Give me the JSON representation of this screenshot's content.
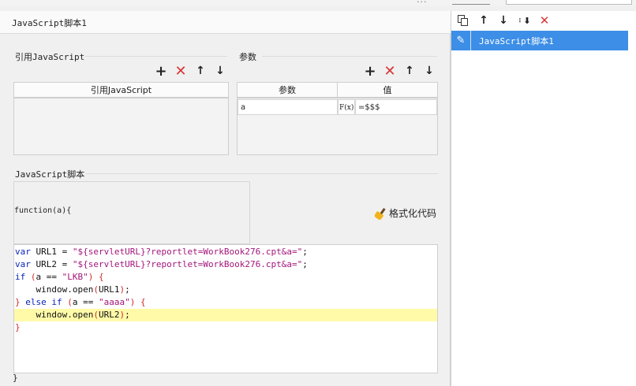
{
  "top": {
    "overflow_dots": "···"
  },
  "editor_panel": {
    "title": "JavaScript脚本1",
    "imports": {
      "group_label": "引用JavaScript",
      "column_header": "引用JavaScript"
    },
    "params": {
      "group_label": "参数",
      "columns": [
        "参数",
        "值"
      ],
      "rows": [
        {
          "name": "a",
          "formula_button": "F(x)",
          "value": "=$$$"
        }
      ]
    },
    "script": {
      "group_label": "JavaScript脚本",
      "signature": "function(a){",
      "format_button": "格式化代码",
      "closing": "}",
      "lines": [
        {
          "tokens": [
            {
              "c": "kw",
              "t": "var"
            },
            {
              "c": "plain",
              "t": " URL1 = "
            },
            {
              "c": "str",
              "t": "\"${servletURL}?reportlet=WorkBook276.cpt&a=\""
            },
            {
              "c": "plain",
              "t": ";"
            }
          ]
        },
        {
          "tokens": [
            {
              "c": "kw",
              "t": "var"
            },
            {
              "c": "plain",
              "t": " URL2 = "
            },
            {
              "c": "str",
              "t": "\"${servletURL}?reportlet=WorkBook276.cpt&a=\""
            },
            {
              "c": "plain",
              "t": ";"
            }
          ]
        },
        {
          "tokens": [
            {
              "c": "kw",
              "t": "if"
            },
            {
              "c": "plain",
              "t": " "
            },
            {
              "c": "br",
              "t": "("
            },
            {
              "c": "plain",
              "t": "a == "
            },
            {
              "c": "str",
              "t": "\"LKB\""
            },
            {
              "c": "br",
              "t": ")"
            },
            {
              "c": "plain",
              "t": " "
            },
            {
              "c": "br",
              "t": "{"
            }
          ]
        },
        {
          "tokens": [
            {
              "c": "plain",
              "t": "    window.open"
            },
            {
              "c": "br",
              "t": "("
            },
            {
              "c": "plain",
              "t": "URL1"
            },
            {
              "c": "br",
              "t": ")"
            },
            {
              "c": "plain",
              "t": ";"
            }
          ]
        },
        {
          "tokens": [
            {
              "c": "br",
              "t": "}"
            },
            {
              "c": "plain",
              "t": " "
            },
            {
              "c": "kw",
              "t": "else if"
            },
            {
              "c": "plain",
              "t": " "
            },
            {
              "c": "br",
              "t": "("
            },
            {
              "c": "plain",
              "t": "a == "
            },
            {
              "c": "str",
              "t": "\"aaaa\""
            },
            {
              "c": "br",
              "t": ")"
            },
            {
              "c": "plain",
              "t": " "
            },
            {
              "c": "br",
              "t": "{"
            }
          ]
        },
        {
          "highlight": true,
          "tokens": [
            {
              "c": "plain",
              "t": "    window.open"
            },
            {
              "c": "br",
              "t": "("
            },
            {
              "c": "plain",
              "t": "URL2"
            },
            {
              "c": "br",
              "t": ")"
            },
            {
              "c": "plain",
              "t": ";"
            }
          ]
        },
        {
          "tokens": [
            {
              "c": "br",
              "t": "}"
            }
          ]
        }
      ]
    }
  },
  "toolbar_icons": {
    "add": "+",
    "delete": "✕",
    "up": "↑",
    "down": "↓"
  },
  "right_panel": {
    "icons": {
      "up": "↑",
      "down": "↓",
      "delete": "✕",
      "pen": "✎"
    },
    "items": [
      {
        "label": "JavaScript脚本1",
        "selected": true
      }
    ]
  },
  "colors": {
    "keyword": "#0a24b8",
    "string": "#a3157a",
    "bracket": "#d42a2a",
    "delete_red": "#d93434",
    "selection_blue": "#3c8ee6",
    "highlight_line": "#fffaa8"
  }
}
